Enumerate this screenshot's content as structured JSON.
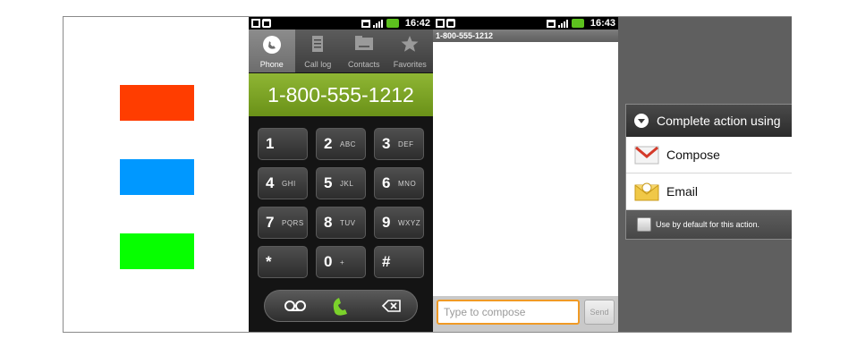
{
  "colors": {
    "swatch_red": "#ff3d00",
    "swatch_blue": "#0098ff",
    "swatch_green": "#06ff00",
    "dialer_accent": "#7ea52a",
    "compose_border": "#f09a25"
  },
  "status_bar": {
    "time_dialer": "16:42",
    "time_messaging": "16:43"
  },
  "dialer": {
    "tabs": [
      {
        "label": "Phone",
        "icon": "phone-icon",
        "active": true
      },
      {
        "label": "Call log",
        "icon": "call-log-icon",
        "active": false
      },
      {
        "label": "Contacts",
        "icon": "contacts-icon",
        "active": false
      },
      {
        "label": "Favorites",
        "icon": "star-icon",
        "active": false
      }
    ],
    "number": "1-800-555-1212",
    "keys": [
      {
        "digit": "1",
        "letters": ""
      },
      {
        "digit": "2",
        "letters": "ABC"
      },
      {
        "digit": "3",
        "letters": "DEF"
      },
      {
        "digit": "4",
        "letters": "GHI"
      },
      {
        "digit": "5",
        "letters": "JKL"
      },
      {
        "digit": "6",
        "letters": "MNO"
      },
      {
        "digit": "7",
        "letters": "PQRS"
      },
      {
        "digit": "8",
        "letters": "TUV"
      },
      {
        "digit": "9",
        "letters": "WXYZ"
      },
      {
        "digit": "*",
        "letters": ""
      },
      {
        "digit": "0",
        "letters": "+"
      },
      {
        "digit": "#",
        "letters": ""
      }
    ],
    "action_icons": [
      "voicemail-icon",
      "call-icon",
      "backspace-icon"
    ]
  },
  "messaging": {
    "recipient": "1-800-555-1212",
    "compose_placeholder": "Type to compose",
    "send_label": "Send"
  },
  "chooser": {
    "title": "Complete action using",
    "options": [
      {
        "label": "Compose",
        "icon": "gmail-icon"
      },
      {
        "label": "Email",
        "icon": "email-icon"
      }
    ],
    "default_label": "Use by default for this action."
  }
}
